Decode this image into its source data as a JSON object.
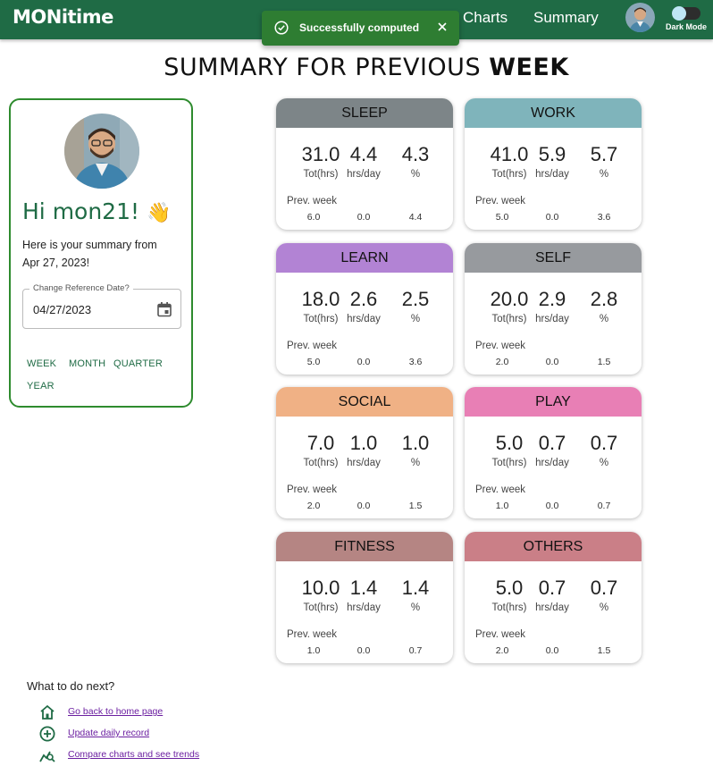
{
  "header": {
    "brand": "MONitime",
    "nav": [
      {
        "label": "Charts"
      },
      {
        "label": "Summary"
      }
    ],
    "dark_mode_label": "Dark Mode",
    "bg_color": "#1f6b45"
  },
  "snackbar": {
    "message": "Successfully computed",
    "icon": "check-circle-icon",
    "close_icon": "close-icon"
  },
  "page_title": {
    "prefix": "SUMMARY FOR PREVIOUS",
    "period": "WEEK"
  },
  "profile": {
    "greeting": "Hi mon21!",
    "wave": "👋",
    "summary_line1": "Here is your summary from",
    "summary_line2": "Apr 27, 2023!",
    "date_field": {
      "label": "Change Reference Date?",
      "value": "04/27/2023",
      "icon": "calendar-icon"
    },
    "periods": [
      "WEEK",
      "MONTH",
      "QUARTER",
      "YEAR"
    ]
  },
  "stat_labels": {
    "total": "Tot(hrs)",
    "per_day": "hrs/day",
    "percent": "%",
    "prev_week": "Prev. week"
  },
  "categories": [
    {
      "name": "SLEEP",
      "color": "#7d8588",
      "tot": "31.0",
      "per_day": "4.4",
      "pct": "4.3",
      "prev_tot": "6.0",
      "prev_day": "0.0",
      "prev_pct": "4.4"
    },
    {
      "name": "WORK",
      "color": "#7fb4bb",
      "tot": "41.0",
      "per_day": "5.9",
      "pct": "5.7",
      "prev_tot": "5.0",
      "prev_day": "0.0",
      "prev_pct": "3.6"
    },
    {
      "name": "LEARN",
      "color": "#b283d4",
      "tot": "18.0",
      "per_day": "2.6",
      "pct": "2.5",
      "prev_tot": "5.0",
      "prev_day": "0.0",
      "prev_pct": "3.6"
    },
    {
      "name": "SELF",
      "color": "#979a9e",
      "tot": "20.0",
      "per_day": "2.9",
      "pct": "2.8",
      "prev_tot": "2.0",
      "prev_day": "0.0",
      "prev_pct": "1.5"
    },
    {
      "name": "SOCIAL",
      "color": "#f0b185",
      "tot": "7.0",
      "per_day": "1.0",
      "pct": "1.0",
      "prev_tot": "2.0",
      "prev_day": "0.0",
      "prev_pct": "1.5"
    },
    {
      "name": "PLAY",
      "color": "#e87fb5",
      "tot": "5.0",
      "per_day": "0.7",
      "pct": "0.7",
      "prev_tot": "1.0",
      "prev_day": "0.0",
      "prev_pct": "0.7"
    },
    {
      "name": "FITNESS",
      "color": "#b58583",
      "tot": "10.0",
      "per_day": "1.4",
      "pct": "1.4",
      "prev_tot": "1.0",
      "prev_day": "0.0",
      "prev_pct": "0.7"
    },
    {
      "name": "OTHERS",
      "color": "#ca7f87",
      "tot": "5.0",
      "per_day": "0.7",
      "pct": "0.7",
      "prev_tot": "2.0",
      "prev_day": "0.0",
      "prev_pct": "1.5"
    }
  ],
  "next": {
    "title": "What to do next?",
    "links": [
      {
        "label": "Go back to home page",
        "icon": "home-icon"
      },
      {
        "label": "Update daily record",
        "icon": "add-circle-icon"
      },
      {
        "label": "Compare charts and see trends",
        "icon": "chart-search-icon"
      }
    ],
    "link_color": "#6b1fa0"
  }
}
